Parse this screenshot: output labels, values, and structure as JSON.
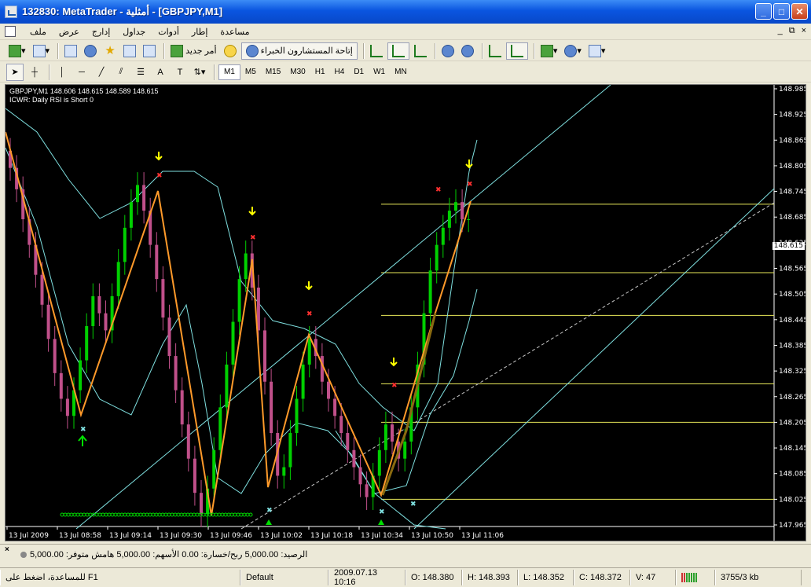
{
  "window": {
    "title": "132830: MetaTrader - أمثلية - [GBPJPY,M1]",
    "minimize_label": "_",
    "maximize_label": "□",
    "close_label": "✕"
  },
  "menu": {
    "items": [
      "ملف",
      "عرض",
      "إدارج",
      "جداول",
      "أدوات",
      "إطار",
      "مساعدة"
    ],
    "mdi": [
      "_",
      "⧉",
      "×"
    ]
  },
  "toolbar": {
    "new_order_label": "أمر جديد",
    "expert_advisors_label": "إتاحة المستشارون الخبراء"
  },
  "timeframes": {
    "items": [
      "M1",
      "M5",
      "M15",
      "M30",
      "H1",
      "H4",
      "D1",
      "W1",
      "MN"
    ],
    "active": "M1"
  },
  "chart": {
    "symbol_line": "GBPJPY,M1  148.606 148.615 148.589 148.615",
    "indicator_line": "ICWR: Daily RSI is Short 0",
    "current_price": "148.615",
    "price_labels": [
      "148.985",
      "148.925",
      "148.865",
      "148.805",
      "148.745",
      "148.685",
      "148.625",
      "148.565",
      "148.505",
      "148.445",
      "148.385",
      "148.325",
      "148.265",
      "148.205",
      "148.145",
      "148.085",
      "148.025",
      "147.965"
    ],
    "time_labels": [
      "13 Jul 2009",
      "13 Jul 08:58",
      "13 Jul 09:14",
      "13 Jul 09:30",
      "13 Jul 09:46",
      "13 Jul 10:02",
      "13 Jul 10:18",
      "13 Jul 10:34",
      "13 Jul 10:50",
      "13 Jul 11:06"
    ],
    "colors": {
      "background": "#000000",
      "bull": "#00d000",
      "bear": "#c0508a",
      "channel": "#7fe0e0",
      "fib": "#e8e85a",
      "zigzag": "#ff9a2a",
      "arrow": "#ffff00"
    }
  },
  "terminal": {
    "close_label": "×",
    "account_text": "الرصيد: 5,000.00  ربح/خسارة: 0.00  الأسهم: 5,000.00  هامش متوفر: 5,000.00"
  },
  "status": {
    "help": "للمساعدة، اضغط على F1",
    "profile": "Default",
    "datetime": "2009.07.13 10:16",
    "open": "O: 148.380",
    "high": "H: 148.393",
    "low": "L: 148.352",
    "close": "C: 148.372",
    "volume": "V: 47",
    "traffic": "3755/3 kb"
  }
}
